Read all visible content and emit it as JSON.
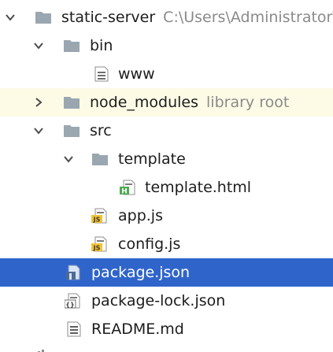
{
  "tree": {
    "root": {
      "label": "static-server",
      "hint": "C:\\Users\\Administrator\\"
    },
    "bin": {
      "label": "bin",
      "www": "www"
    },
    "node_modules": {
      "label": "node_modules",
      "hint": "library root"
    },
    "src": {
      "label": "src",
      "template": "template",
      "template_html": "template.html",
      "app_js": "app.js",
      "config_js": "config.js"
    },
    "package_json": "package.json",
    "package_lock_json": "package-lock.json",
    "readme": "README.md"
  },
  "icons": {
    "folder_color": "#9aa7b0",
    "html_badge": "H",
    "js_badge": "JS",
    "json_badge": "{}"
  },
  "colors": {
    "selection": "#2f65ca",
    "library_row": "#fdfbe6",
    "hint_text": "#8a8a8a"
  }
}
